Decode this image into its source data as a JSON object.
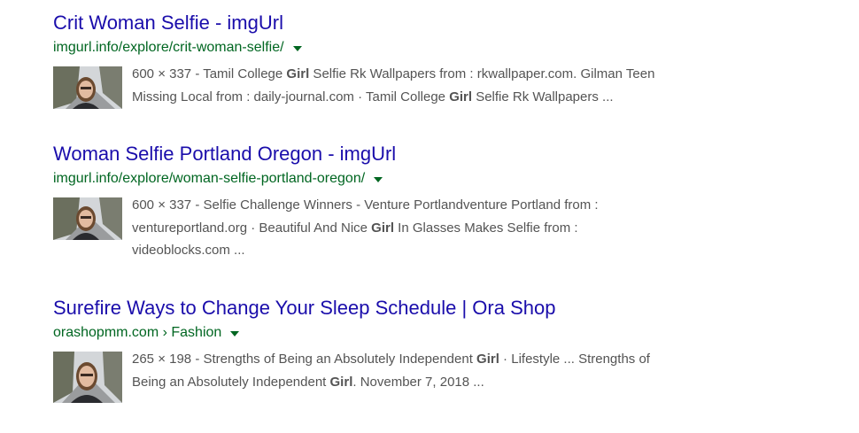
{
  "results": [
    {
      "title": "Crit Woman Selfie - imgUrl",
      "url": "imgurl.info/explore/crit-woman-selfie/",
      "thumb_alt": "selfie-thumbnail",
      "snippet_lines": [
        [
          "600 × 337 - Tamil College ",
          "Girl",
          " Selfie Rk Wallpapers from : rkwallpaper.com. Gilman Teen"
        ],
        [
          "Missing Local from : daily-journal.com · Tamil College ",
          "Girl",
          " Selfie Rk Wallpapers ..."
        ]
      ]
    },
    {
      "title": "Woman Selfie Portland Oregon - imgUrl",
      "url": "imgurl.info/explore/woman-selfie-portland-oregon/",
      "thumb_alt": "selfie-thumbnail",
      "snippet_lines": [
        [
          "600 × 337 - Selfie Challenge Winners - Venture Portlandventure Portland from :",
          "",
          ""
        ],
        [
          "ventureportland.org · Beautiful And Nice ",
          "Girl",
          " In Glasses Makes Selfie from :"
        ],
        [
          "videoblocks.com ...",
          "",
          ""
        ]
      ]
    },
    {
      "title": "Surefire Ways to Change Your Sleep Schedule | Ora Shop",
      "url": "orashopmm.com › Fashion",
      "thumb_alt": "selfie-thumbnail",
      "snippet_lines": [
        [
          "265 × 198 - Strengths of Being an Absolutely Independent ",
          "Girl",
          " · Lifestyle ... Strengths of"
        ],
        [
          "Being an Absolutely Independent ",
          "Girl",
          ". November 7, 2018 ..."
        ]
      ]
    }
  ],
  "colors": {
    "title": "#1a0dab",
    "url": "#006621",
    "snippet": "#545454"
  }
}
